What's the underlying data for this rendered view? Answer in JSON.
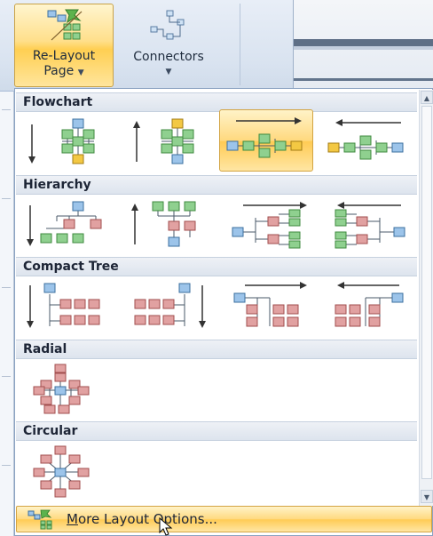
{
  "ribbon": {
    "relayout": {
      "line1": "Re-Layout",
      "line2": "Page",
      "caret": "▼",
      "icon": "relayout-page-icon"
    },
    "connectors": {
      "label": "Connectors",
      "caret": "▼",
      "icon": "connectors-icon"
    }
  },
  "menu": {
    "sections": [
      {
        "title": "Flowchart"
      },
      {
        "title": "Hierarchy"
      },
      {
        "title": "Compact Tree"
      },
      {
        "title": "Radial"
      },
      {
        "title": "Circular"
      }
    ],
    "more": {
      "underline_char": "M",
      "rest": "ore Layout Options..."
    }
  },
  "colors": {
    "accent_highlight": "#ffd97f",
    "node_blue": "#9cc4ea",
    "node_green": "#8fd08f",
    "node_yellow": "#f3c843",
    "node_red": "#e1a1a1"
  }
}
